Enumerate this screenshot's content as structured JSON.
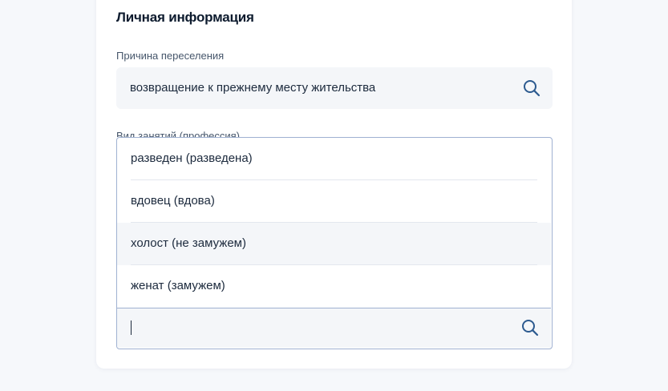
{
  "section": {
    "title": "Личная информация"
  },
  "reason_field": {
    "label": "Причина переселения",
    "value": "возвращение к прежнему месту жительства",
    "icon": "search-icon"
  },
  "occupation_field": {
    "label": "Вид занятий (профессия)",
    "options": [
      {
        "label": "разведен (разведена)"
      },
      {
        "label": "вдовец (вдова)"
      },
      {
        "label": "холост (не замужем)"
      },
      {
        "label": "женат (замужем)"
      }
    ],
    "highlighted_index": 2,
    "input_value": "",
    "icon": "search-icon"
  },
  "colors": {
    "accent": "#1d5deb",
    "icon": "#2c5a8f",
    "text": "#1c2a3d",
    "input_bg": "#f4f6f9",
    "border_focus": "#9fb1d1"
  }
}
